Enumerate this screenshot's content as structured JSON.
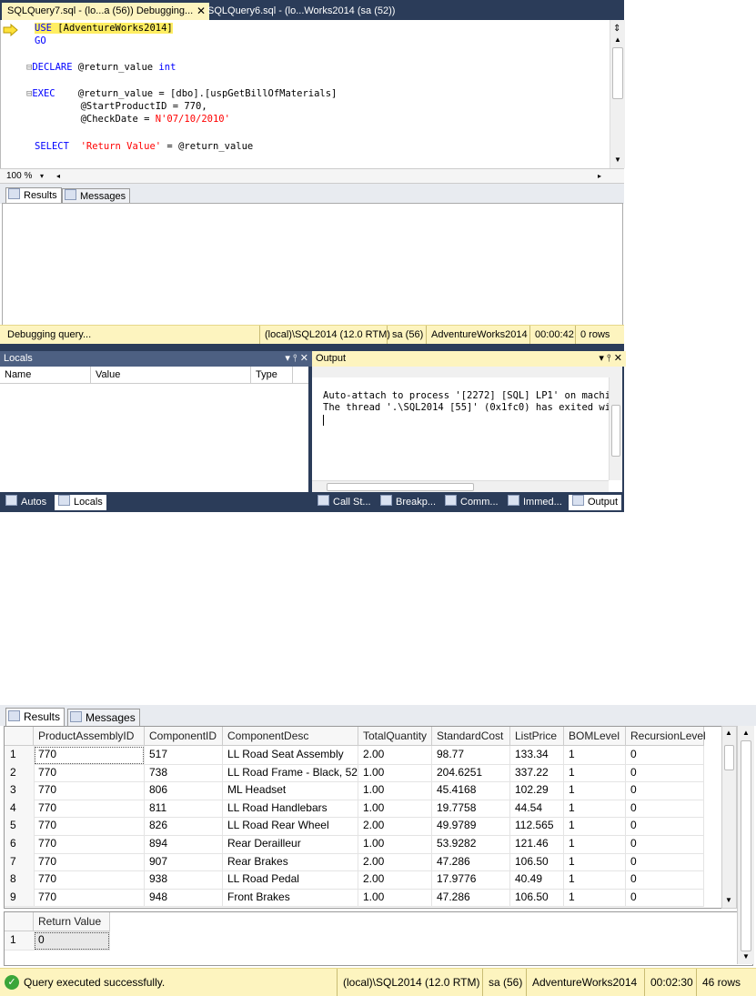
{
  "tabs": [
    {
      "label": "SQLQuery7.sql - (lo...a (56)) Debugging...",
      "close": "✕"
    },
    {
      "label": "SQLQuery6.sql - (lo...Works2014 (sa (52))"
    }
  ],
  "editor": {
    "lines": [
      {
        "tokens": [
          [
            "kw",
            "USE"
          ],
          [
            "plain",
            " "
          ],
          [
            "plain",
            "[AdventureWorks2014]"
          ]
        ],
        "highlight": true
      },
      {
        "tokens": [
          [
            "kw",
            "GO"
          ]
        ]
      },
      {
        "tokens": [
          [
            "gray",
            "⊟"
          ],
          [
            "kw",
            "DECLARE"
          ],
          [
            "plain",
            " @return_value "
          ],
          [
            "kw",
            "int"
          ]
        ]
      },
      {
        "tokens": [
          [
            "gray",
            "⊟"
          ],
          [
            "kw",
            "EXEC"
          ],
          [
            "plain",
            "    @return_value = [dbo].[uspGetBillOfMaterials]"
          ]
        ]
      },
      {
        "tokens": [
          [
            "plain",
            "        @StartProductID = 770,"
          ]
        ]
      },
      {
        "tokens": [
          [
            "plain",
            "        @CheckDate = "
          ],
          [
            "str",
            "N'07/10/2010'"
          ]
        ]
      },
      {
        "tokens": [
          [
            "kw",
            "SELECT"
          ],
          [
            "plain",
            "  "
          ],
          [
            "str",
            "'Return Value'"
          ],
          [
            "plain",
            " = @return_value"
          ]
        ]
      }
    ],
    "zoom": "100 %"
  },
  "results_tabs": {
    "results": "Results",
    "messages": "Messages"
  },
  "status_top": {
    "message": "Debugging query...",
    "server": "(local)\\SQL2014 (12.0 RTM)",
    "user": "sa (56)",
    "database": "AdventureWorks2014",
    "time": "00:00:42",
    "rows": "0 rows"
  },
  "locals": {
    "title": "Locals",
    "columns": [
      "Name",
      "Value",
      "Type"
    ],
    "icons": "▾ ⫯ ✕"
  },
  "output": {
    "title": "Output",
    "icons": "▾ ⫯ ✕",
    "lines": [
      "Auto-attach to process '[2272] [SQL] LP1' on machi",
      "The thread '.\\SQL2014 [55]' (0x1fc0) has exited wi"
    ]
  },
  "bottom_tabs": [
    "Autos",
    "Locals",
    "Call St...",
    "Breakp...",
    "Comm...",
    "Immed...",
    "Output"
  ],
  "grid": {
    "columns": [
      "ProductAssemblyID",
      "ComponentID",
      "ComponentDesc",
      "TotalQuantity",
      "StandardCost",
      "ListPrice",
      "BOMLevel",
      "RecursionLevel"
    ],
    "rows": [
      [
        "1",
        "770",
        "517",
        "LL Road Seat Assembly",
        "2.00",
        "98.77",
        "133.34",
        "1",
        "0"
      ],
      [
        "2",
        "770",
        "738",
        "LL Road Frame - Black, 52",
        "1.00",
        "204.6251",
        "337.22",
        "1",
        "0"
      ],
      [
        "3",
        "770",
        "806",
        "ML Headset",
        "1.00",
        "45.4168",
        "102.29",
        "1",
        "0"
      ],
      [
        "4",
        "770",
        "811",
        "LL Road Handlebars",
        "1.00",
        "19.7758",
        "44.54",
        "1",
        "0"
      ],
      [
        "5",
        "770",
        "826",
        "LL Road Rear Wheel",
        "2.00",
        "49.9789",
        "112.565",
        "1",
        "0"
      ],
      [
        "6",
        "770",
        "894",
        "Rear Derailleur",
        "1.00",
        "53.9282",
        "121.46",
        "1",
        "0"
      ],
      [
        "7",
        "770",
        "907",
        "Rear Brakes",
        "2.00",
        "47.286",
        "106.50",
        "1",
        "0"
      ],
      [
        "8",
        "770",
        "938",
        "LL Road Pedal",
        "2.00",
        "17.9776",
        "40.49",
        "1",
        "0"
      ],
      [
        "9",
        "770",
        "948",
        "Front Brakes",
        "1.00",
        "47.286",
        "106.50",
        "1",
        "0"
      ]
    ]
  },
  "grid2": {
    "column": "Return Value",
    "row_num": "1",
    "value": "0"
  },
  "status_bottom": {
    "message": "Query executed successfully.",
    "server": "(local)\\SQL2014 (12.0 RTM)",
    "user": "sa (56)",
    "database": "AdventureWorks2014",
    "time": "00:02:30",
    "rows": "46 rows"
  },
  "colors": {
    "ide_dark": "#2b3c59",
    "status_yellow": "#fdf4bf",
    "keyword": "#0000ff",
    "string": "#ff0000"
  }
}
